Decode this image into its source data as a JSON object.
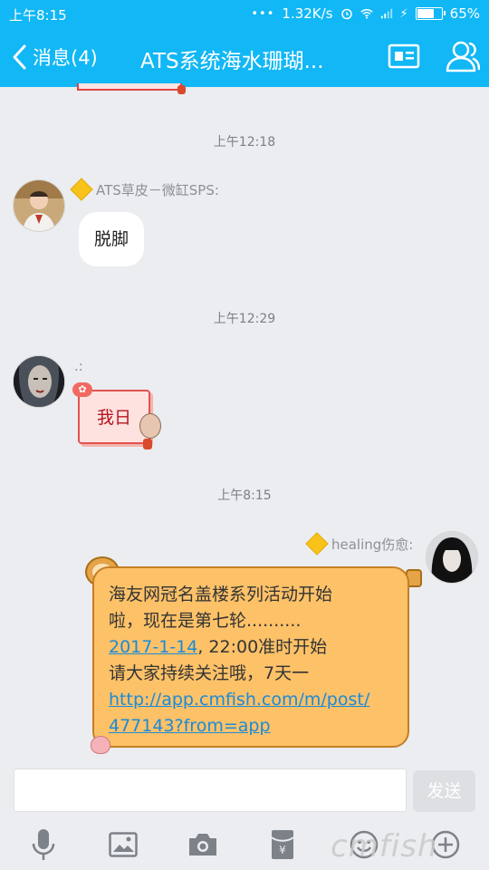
{
  "status_bar": {
    "time": "上午8:15",
    "network_speed": "1.32K/s",
    "battery": "65%",
    "battery_level": 0.65
  },
  "header": {
    "back_label": "消息(4)",
    "title": "ATS系统海水珊瑚...",
    "icons": [
      "back-chevron-icon",
      "profile-card-icon",
      "group-members-icon"
    ]
  },
  "messages": [
    {
      "timestamp": "上午12:18",
      "sender": "ATS草皮－微缸SPS:",
      "text": "脱脚",
      "side": "left",
      "style": "white-bubble"
    },
    {
      "timestamp": "上午12:29",
      "sender": ".:",
      "text": "我日",
      "side": "left",
      "style": "red-festive-bubble"
    },
    {
      "timestamp": "上午8:15",
      "sender": "healing伤愈:",
      "side": "right",
      "style": "orange-monkey-bubble",
      "lines": {
        "l1": "海友网冠名盖楼系列活动开始",
        "l2": "啦，现在是第七轮..........",
        "l3_link": "2017-1-14",
        "l3_rest": ", 22:00准时开始",
        "l4": "请大家持续关注哦，7天一",
        "l5_link": "http://app.cmfish.com/m/post/",
        "l6_link": "477143?from=app"
      }
    }
  ],
  "composer": {
    "input_value": "",
    "send_label": "发送",
    "tools": [
      "microphone-icon",
      "image-icon",
      "camera-icon",
      "red-packet-icon",
      "emoji-icon",
      "plus-icon"
    ]
  },
  "watermark": "cmfish",
  "colors": {
    "header": "#12b7f5",
    "background": "#ebedf0",
    "link": "#1a8bd9",
    "orange_bubble": "#fdc168"
  }
}
